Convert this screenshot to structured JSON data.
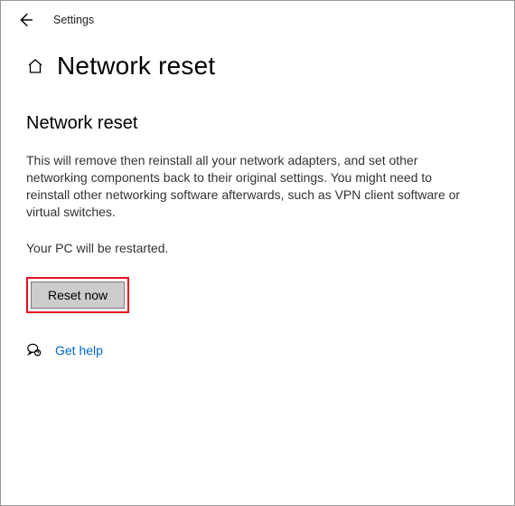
{
  "titlebar": {
    "label": "Settings"
  },
  "header": {
    "title": "Network reset"
  },
  "section": {
    "subtitle": "Network reset",
    "description": "This will remove then reinstall all your network adapters, and set other networking components back to their original settings. You might need to reinstall other networking software afterwards, such as VPN client software or virtual switches.",
    "restart_note": "Your PC will be restarted."
  },
  "actions": {
    "reset_label": "Reset now"
  },
  "help": {
    "link_label": "Get help"
  }
}
